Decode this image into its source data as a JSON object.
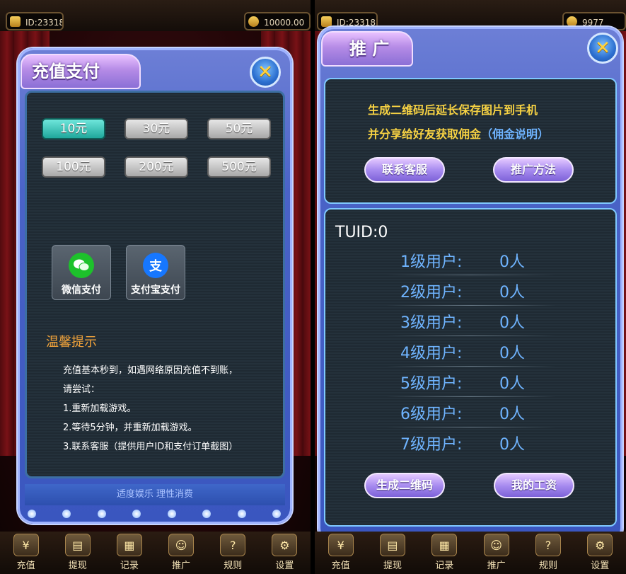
{
  "left": {
    "topbar": {
      "id_label": "ID:23318",
      "coins": "10000.00"
    },
    "panel_title": "充值支付",
    "close_icon": "close-x-icon",
    "amounts": [
      "10元",
      "30元",
      "50元",
      "100元",
      "200元",
      "500元"
    ],
    "selected_amount": "10元",
    "payments": [
      {
        "label": "微信支付",
        "icon": "wechat-icon",
        "color": "#1dc12b"
      },
      {
        "label": "支付宝支付",
        "icon": "alipay-icon",
        "glyph": "支",
        "color": "#1677ff"
      }
    ],
    "tips_title": "温馨提示",
    "tips": [
      "充值基本秒到，如遇网络原因充值不到账，",
      "请尝试：",
      "1.重新加载游戏。",
      "2.等待5分钟，并重新加载游戏。",
      "3.联系客服（提供用户ID和支付订单截图）"
    ],
    "footer": "适度娱乐 理性消费"
  },
  "right": {
    "topbar": {
      "id_label": "ID:23318",
      "coins": "9977"
    },
    "panel_title": "推 广",
    "close_icon": "close-x-icon",
    "instruction_line1": "生成二维码后延长保存图片到手机",
    "instruction_line2": "并分享给好友获取佣金",
    "commission_link": "（佣金说明）",
    "contact_button": "联系客服",
    "method_button": "推广方法",
    "tuid": "TUID:0",
    "levels": [
      {
        "label": "1级用户:",
        "count": "0人"
      },
      {
        "label": "2级用户:",
        "count": "0人"
      },
      {
        "label": "3级用户:",
        "count": "0人"
      },
      {
        "label": "4级用户:",
        "count": "0人"
      },
      {
        "label": "5级用户:",
        "count": "0人"
      },
      {
        "label": "6级用户:",
        "count": "0人"
      },
      {
        "label": "7级用户:",
        "count": "0人"
      }
    ],
    "qr_button": "生成二维码",
    "salary_button": "我的工资"
  },
  "bottom_nav": [
    {
      "label": "充值",
      "icon": "recharge-icon"
    },
    {
      "label": "提现",
      "icon": "withdraw-icon"
    },
    {
      "label": "记录",
      "icon": "record-icon"
    },
    {
      "label": "推广",
      "icon": "promote-icon"
    },
    {
      "label": "规则",
      "icon": "help-icon"
    },
    {
      "label": "设置",
      "icon": "settings-icon"
    }
  ],
  "colors": {
    "accent_blue": "#6fb4ff",
    "tip_orange": "#f1a33b",
    "promo_yellow": "#f7d243"
  }
}
